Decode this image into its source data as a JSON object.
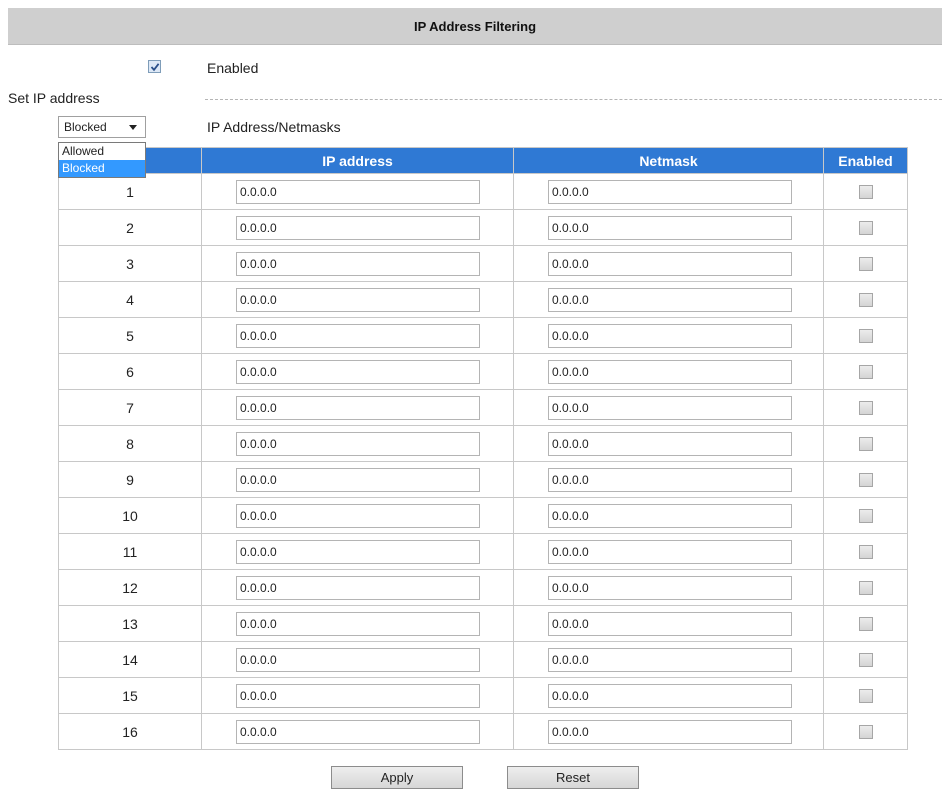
{
  "header": {
    "title": "IP Address Filtering"
  },
  "filter": {
    "enabled_label": "Enabled",
    "enabled": true
  },
  "set_ip": {
    "label": "Set IP address",
    "mode_selected": "Blocked",
    "mode_options": [
      "Allowed",
      "Blocked"
    ],
    "list_label": "IP Address/Netmasks"
  },
  "table": {
    "columns": [
      "",
      "IP address",
      "Netmask",
      "Enabled"
    ],
    "rows": [
      {
        "index": "1",
        "ip": "0.0.0.0",
        "netmask": "0.0.0.0",
        "enabled": false
      },
      {
        "index": "2",
        "ip": "0.0.0.0",
        "netmask": "0.0.0.0",
        "enabled": false
      },
      {
        "index": "3",
        "ip": "0.0.0.0",
        "netmask": "0.0.0.0",
        "enabled": false
      },
      {
        "index": "4",
        "ip": "0.0.0.0",
        "netmask": "0.0.0.0",
        "enabled": false
      },
      {
        "index": "5",
        "ip": "0.0.0.0",
        "netmask": "0.0.0.0",
        "enabled": false
      },
      {
        "index": "6",
        "ip": "0.0.0.0",
        "netmask": "0.0.0.0",
        "enabled": false
      },
      {
        "index": "7",
        "ip": "0.0.0.0",
        "netmask": "0.0.0.0",
        "enabled": false
      },
      {
        "index": "8",
        "ip": "0.0.0.0",
        "netmask": "0.0.0.0",
        "enabled": false
      },
      {
        "index": "9",
        "ip": "0.0.0.0",
        "netmask": "0.0.0.0",
        "enabled": false
      },
      {
        "index": "10",
        "ip": "0.0.0.0",
        "netmask": "0.0.0.0",
        "enabled": false
      },
      {
        "index": "11",
        "ip": "0.0.0.0",
        "netmask": "0.0.0.0",
        "enabled": false
      },
      {
        "index": "12",
        "ip": "0.0.0.0",
        "netmask": "0.0.0.0",
        "enabled": false
      },
      {
        "index": "13",
        "ip": "0.0.0.0",
        "netmask": "0.0.0.0",
        "enabled": false
      },
      {
        "index": "14",
        "ip": "0.0.0.0",
        "netmask": "0.0.0.0",
        "enabled": false
      },
      {
        "index": "15",
        "ip": "0.0.0.0",
        "netmask": "0.0.0.0",
        "enabled": false
      },
      {
        "index": "16",
        "ip": "0.0.0.0",
        "netmask": "0.0.0.0",
        "enabled": false
      }
    ]
  },
  "buttons": {
    "apply": "Apply",
    "reset": "Reset"
  },
  "colors": {
    "header_bg": "#cfcfcf",
    "table_header": "#2f79d4",
    "selected_option": "#3399ff"
  }
}
